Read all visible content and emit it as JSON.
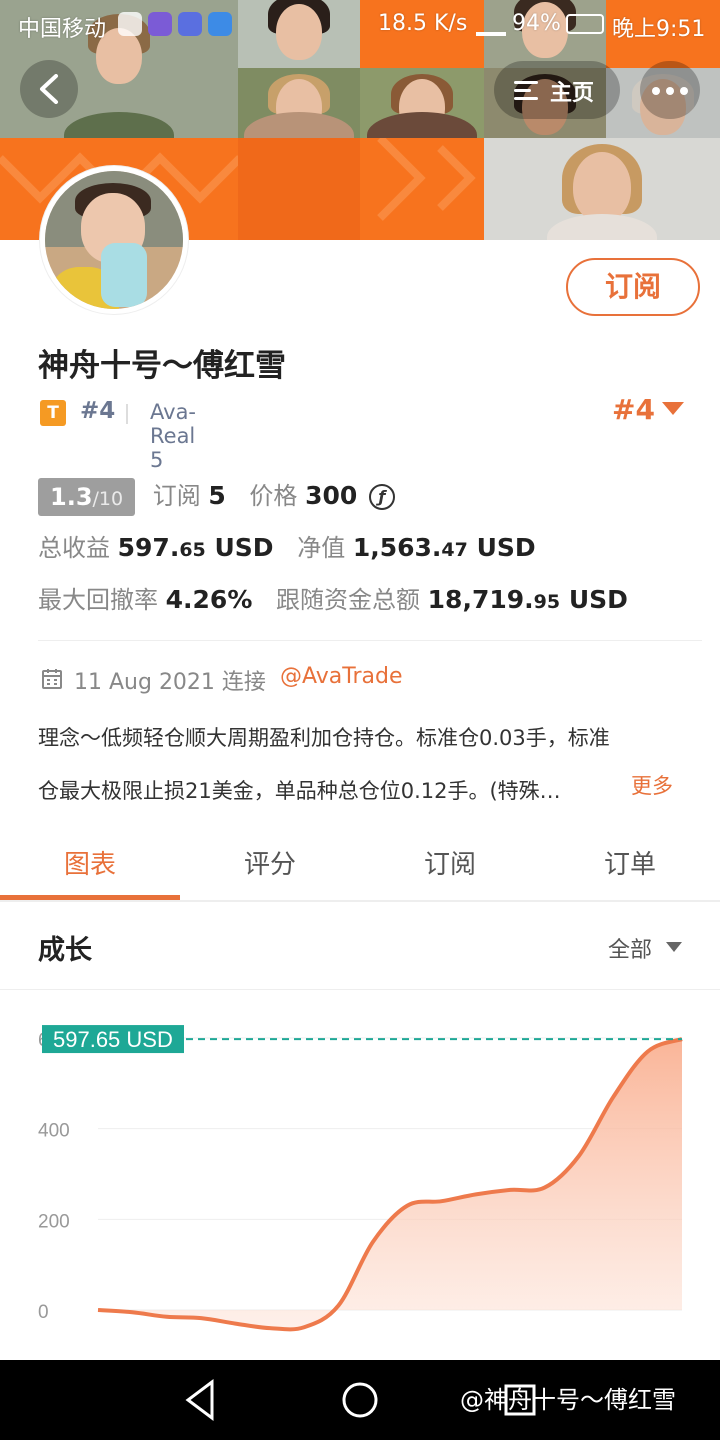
{
  "status_bar": {
    "carrier": "中国移动",
    "speed": "18.5 K/s",
    "battery": "94%",
    "time": "晚上9:51"
  },
  "header": {
    "back_icon": "chevron-left-icon",
    "home_label": "主页",
    "more_icon": "ellipsis-icon",
    "brand_color": "#f7731e"
  },
  "profile": {
    "subscribe_label": "订阅",
    "name": "神舟十号～傅红雪",
    "tier_badge": "T",
    "rank_small": "#4",
    "account": "Ava-Real 5",
    "rank_big": "#4"
  },
  "stats": {
    "rating_main": "1.3",
    "rating_denom": "/10",
    "subscribers_label": "订阅",
    "subscribers_value": "5",
    "price_label": "价格",
    "price_value": "300",
    "price_icon": "ƒ",
    "total_profit_label": "总收益",
    "total_profit_int": "597.",
    "total_profit_dec": "65",
    "total_profit_unit": "USD",
    "net_value_label": "净值",
    "net_value_int": "1,563.",
    "net_value_dec": "47",
    "net_value_unit": "USD",
    "max_drawdown_label": "最大回撤率",
    "max_drawdown_value": "4.26%",
    "follow_funds_label": "跟随资金总额",
    "follow_funds_int": "18,719.",
    "follow_funds_dec": "95",
    "follow_funds_unit": "USD"
  },
  "joined": {
    "date": "11 Aug 2021 连接",
    "broker": "@AvaTrade"
  },
  "description": {
    "line1": "理念～低频轻仓顺大周期盈利加仓持仓。标准仓0.03手，标准",
    "line2": "仓最大极限止损21美金，单品种总仓位0.12手。(特殊…",
    "more_label": "更多"
  },
  "tabs": [
    "图表",
    "评分",
    "订阅",
    "订单"
  ],
  "growth": {
    "title": "成长",
    "filter_label": "全部"
  },
  "chart_data": {
    "type": "area",
    "y_ticks": [
      "0",
      "200",
      "400",
      "6"
    ],
    "ylim": [
      0,
      600
    ],
    "last_value_label": "597.65 USD",
    "values": [
      0,
      -5,
      -15,
      -18,
      -30,
      -40,
      -38,
      10,
      150,
      230,
      240,
      255,
      265,
      270,
      340,
      470,
      570,
      597.65
    ],
    "line_color": "#ee7a4c",
    "fill_color": "#f9b89a",
    "ref_line_color": "#1ea896"
  },
  "nav_bar": {
    "watermark": "@神舟十号～傅红雪"
  }
}
